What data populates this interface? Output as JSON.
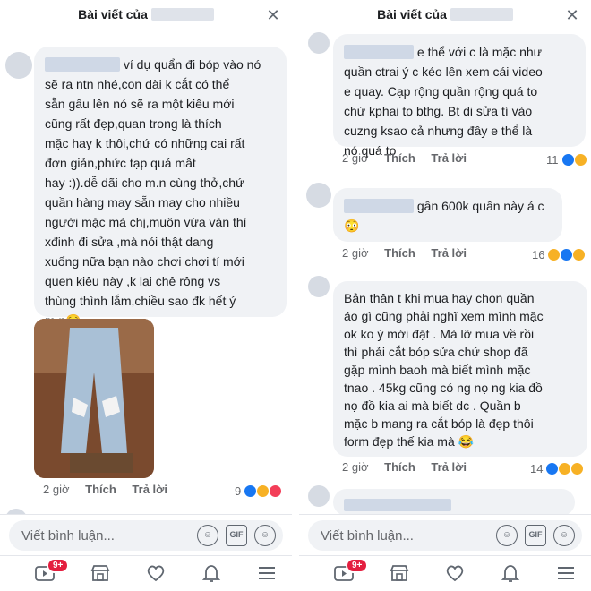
{
  "left": {
    "header": {
      "title_prefix": "Bài viết của",
      "close_glyph": "✕"
    },
    "comment": {
      "first_line": "ví dụ quẩn đi bóp vào nó",
      "text": "sẽ ra ntn nhé,con dài k cắt có thể\nsẵn gấu lên nó sẽ ra một kiêu mới\ncũng rất đẹp,quan trong là thích\nmặc hay k thôi,chứ có những cai rất\nđơn giản,phức tạp quá mât\nhay :)).dễ dãi cho m.n cùng thở,chứ\nquần hàng may sẵn may cho nhiều\nngười mặc mà chị,muôn vừa văn thì\nxđinh đi sửa ,mà nói thật dang\nxuống nữa bạn nào chơi chơi tí mới\nquen kiêu này ,k lại chê rông vs\nthùng thình lắm,chiều sao đk hết ý\nm.n😌",
      "time": "2 giờ",
      "like": "Thích",
      "reply": "Trả lời",
      "react_count": "9"
    }
  },
  "right": {
    "header": {
      "title_prefix": "Bài viết của",
      "close_glyph": "✕"
    },
    "comments": [
      {
        "first_line": "e thể với c là mặc như",
        "text": "quần ctrai ý c kéo lên xem cái video\ne quay. Cạp rộng quần rộng quá to\nchứ kphai to bthg. Bt di sửa tí vào\ncuzng ksao cả nhưng đây e thể là\nnó quá to",
        "time": "2 giờ",
        "like": "Thích",
        "reply": "Trả lời",
        "react_count": "11"
      },
      {
        "first_line": "gần 600k quần này á c",
        "text": "😳",
        "time": "2 giờ",
        "like": "Thích",
        "reply": "Trả lời",
        "react_count": "16"
      },
      {
        "text": "Bản thân t khi mua hay chọn quần\náo gì cũng phải nghĩ xem mình mặc\nok ko ý mới đặt . Mà lỡ mua về rồi\nthì phải cắt bóp sửa chứ shop đã\ngặp mình baoh mà biết mình mặc\ntnao . 45kg cũng có ng nọ ng kia đồ\nnọ đồ kia ai mà biết dc . Quần b\nmặc b mang ra cắt bóp là đẹp thôi\nform đẹp thế kia mà 😂",
        "time": "2 giờ",
        "like": "Thích",
        "reply": "Trả lời",
        "react_count": "14"
      }
    ]
  },
  "composer": {
    "placeholder": "Viết bình luận...",
    "gif_label": "GIF"
  },
  "nav": {
    "video_badge": "9+"
  },
  "colors": {
    "bubble": "#f0f2f5",
    "like_blue": "#1877f2",
    "badge_red": "#e41e3f"
  }
}
